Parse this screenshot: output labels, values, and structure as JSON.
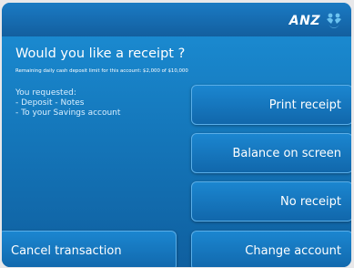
{
  "header": {
    "brand_name": "ANZ",
    "brand_logo_icon": "anz-people-logo-icon"
  },
  "prompt": {
    "title": "Would you like a receipt ?",
    "subtitle": "Remaining daily cash deposit limit for this account: $2,000 of $10,000"
  },
  "request_summary": {
    "heading": "You requested:",
    "lines": [
      "- Deposit - Notes",
      "- To your Savings account"
    ]
  },
  "options": {
    "print_receipt": "Print receipt",
    "balance_on_screen": "Balance on screen",
    "no_receipt": "No receipt",
    "change_account": "Change account",
    "cancel_transaction": "Cancel transaction"
  },
  "colors": {
    "background": "#1579bd",
    "button": "#1167ab",
    "button_border": "#5aaee8",
    "logo_accent": "#6cc3f0"
  }
}
